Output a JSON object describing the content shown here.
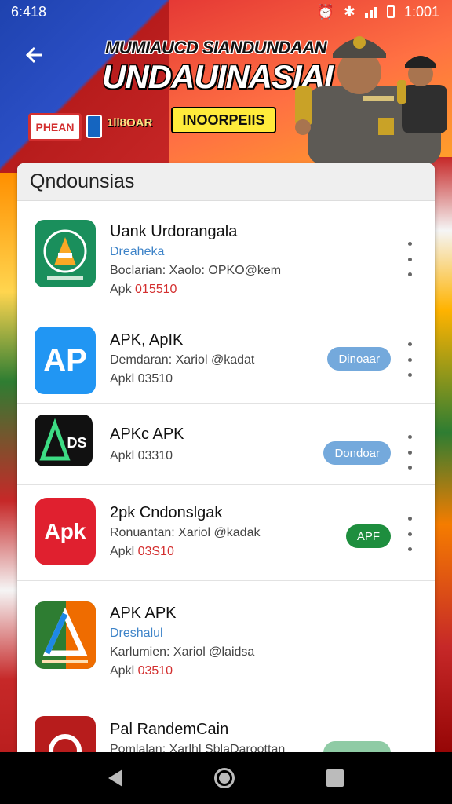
{
  "status_bar": {
    "time": "6:418",
    "right_text": "1:001",
    "icons": [
      "alarm-icon",
      "bluetooth-icon",
      "signal-icon",
      "battery-icon"
    ]
  },
  "header": {
    "back_icon": "arrow-left-icon",
    "title_line1": "MUMIAUCD SIANDUNDAAN",
    "title_line2": "UNDAUINASIAI",
    "badge_red": "PHEAN",
    "badge_text": "1ll8OAR",
    "badge_yellow": "INOORPEIIS"
  },
  "card": {
    "title": "Qndounsias",
    "apps": [
      {
        "name": "Uank Urdorangala",
        "subtitle": "Dreaheka",
        "developer": "Boclarian: Xaolo: OPKO@kem",
        "size_prefix": "Apk",
        "size_value": "015510",
        "button": "",
        "icon": "android-green-icon"
      },
      {
        "name": "APK, ApIK",
        "subtitle": "",
        "developer": "Demdaran: Xariol @kadat",
        "size_prefix": "Apkl",
        "size_value": "03510",
        "button": "Dinoaar",
        "icon": "ap-blue-icon"
      },
      {
        "name": "APKc APK",
        "subtitle": "",
        "developer": "",
        "size_prefix": "Apkl",
        "size_value": "03310",
        "button": "Dondoar",
        "icon": "ads-black-icon"
      },
      {
        "name": "2pk Cndonslgak",
        "subtitle": "",
        "developer": "Ronuantan: Xariol @kadak",
        "size_prefix": "Apkl",
        "size_value": "03S10",
        "button": "APF",
        "icon": "apk-red-icon"
      },
      {
        "name": "APK APK",
        "subtitle": "Dreshalul",
        "developer": "Karlumien: Xariol @laidsa",
        "size_prefix": "Apkl",
        "size_value": "03510",
        "button": "",
        "icon": "triangle-orange-icon"
      },
      {
        "name": "Pal RandemCain",
        "subtitle": "",
        "developer": "Pomlalan: Xarlhl SblaDaroottan",
        "size_prefix": "",
        "size_value": "",
        "button": "",
        "icon": "red-swirl-icon"
      }
    ]
  },
  "navbar": {
    "icons": [
      "nav-back-icon",
      "nav-home-icon",
      "nav-recent-icon"
    ]
  }
}
